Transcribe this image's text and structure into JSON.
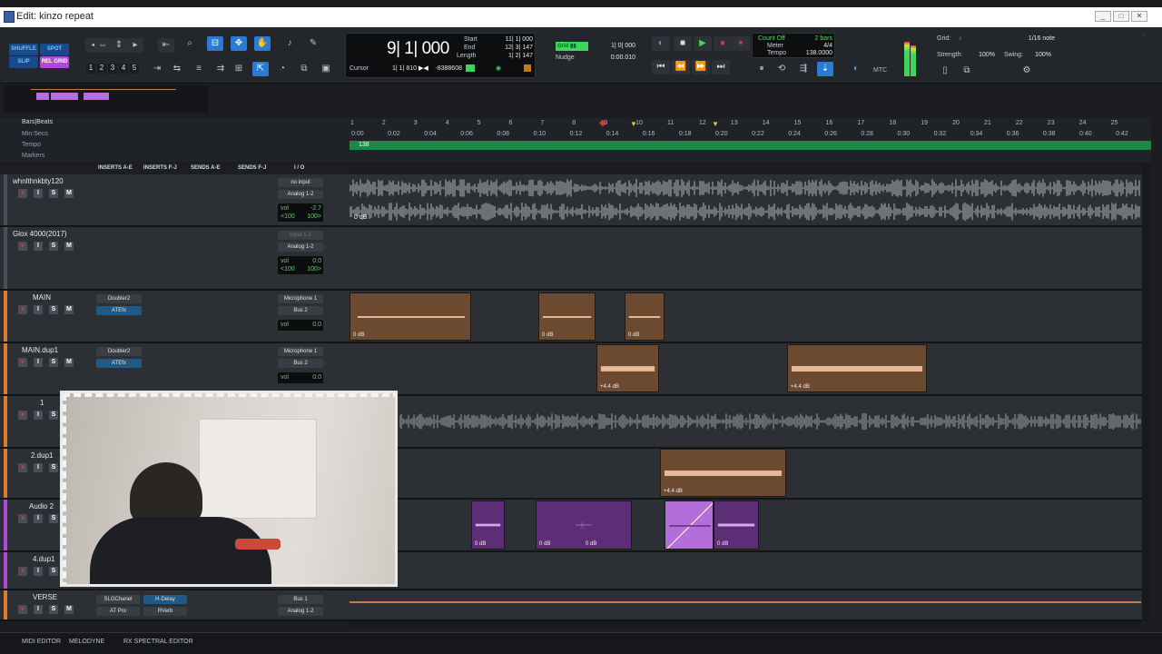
{
  "window": {
    "title": "Edit: kinzo repeat",
    "icon": "pro-tools-icon"
  },
  "modes": {
    "shuffle": "SHUFFLE",
    "spot": "SPOT",
    "slip": "SLIP",
    "grid": "REL GRID"
  },
  "zoom_presets": [
    "1",
    "2",
    "3",
    "4",
    "5"
  ],
  "counter": {
    "main": "9| 1| 000",
    "cursor_label": "Cursor",
    "cursor_value": "1| 1| 810",
    "cursor_extra": "-8388608",
    "start_label": "Start",
    "start_value": "11| 1| 000",
    "end_label": "End",
    "end_value": "12| 3| 147",
    "length_label": "Length",
    "length_value": "1| 2| 147"
  },
  "grid": {
    "grid_label": "Grid",
    "grid_value": "1| 0| 000",
    "nudge_label": "Nudge",
    "nudge_value": "0:00.010"
  },
  "tempo": {
    "count_off_label": "Count Off",
    "count_off_value": "2 bars",
    "meter_label": "Meter",
    "meter_value": "4/4",
    "tempo_label": "Tempo",
    "tempo_value": "138.0000"
  },
  "mtc_label": "MTC",
  "grid_panel": {
    "grid_label": "Grid:",
    "grid_value": "1/16 note",
    "strength_label": "Strength:",
    "strength_value": "100%",
    "swing_label": "Swing:",
    "swing_value": "100%"
  },
  "rulers": {
    "bars_beats": "Bars|Beats",
    "min_secs": "Min:Secs",
    "tempo": "Tempo",
    "markers": "Markers",
    "tempo_marker": "138"
  },
  "bar_ticks": [
    "1",
    "2",
    "3",
    "4",
    "5",
    "6",
    "7",
    "8",
    "9",
    "10",
    "11",
    "12",
    "13",
    "14",
    "15",
    "16",
    "17",
    "18",
    "19",
    "20",
    "21",
    "22",
    "23",
    "24",
    "25"
  ],
  "time_ticks": [
    "0:00",
    "0:02",
    "0:04",
    "0:06",
    "0:08",
    "0:10",
    "0:12",
    "0:14",
    "0:16",
    "0:18",
    "0:20",
    "0:22",
    "0:24",
    "0:26",
    "0:28",
    "0:30",
    "0:32",
    "0:34",
    "0:36",
    "0:38",
    "0:40",
    "0:42"
  ],
  "column_headers": {
    "inserts_ae": "INSERTS A-E",
    "inserts_fj": "INSERTS F-J",
    "sends_ae": "SENDS A-E",
    "sends_fj": "SENDS F-J",
    "io": "I / O"
  },
  "tracks": [
    {
      "name": "whnlthnkbty120",
      "io_in": "no input",
      "io_out": "Analog 1-2",
      "vol": "-2.7",
      "pan_l": "<100",
      "pan_r": "100>",
      "view": "wave",
      "mode": "read",
      "db_label": "0 dB"
    },
    {
      "name": "Glox 4000(2017)",
      "io_in": "Input 1-2",
      "io_out": "Analog 1-2",
      "vol": "0.0",
      "pan_l": "<100",
      "pan_r": "100>",
      "view": "waveform",
      "dyn": "dyn",
      "mode": "read"
    },
    {
      "name": "MAIN",
      "insert1": "Doubler2",
      "insert2": "ATEfx",
      "io_in": "Microphone 1",
      "io_out": "Bus 2",
      "vol": "0.0",
      "view": "wave",
      "mode": "read"
    },
    {
      "name": "MAIN.dup1",
      "insert1": "Doubler2",
      "insert2": "ATEfx",
      "io_in": "Microphone 1",
      "io_out": "Bus 2",
      "vol": "0.0",
      "view": "wave",
      "mode": "read"
    },
    {
      "name": "1",
      "view": "wave"
    },
    {
      "name": "2.dup1",
      "view": "wave"
    },
    {
      "name": "Audio 2",
      "view": "play"
    },
    {
      "name": "4.dup1"
    },
    {
      "name": "VERSE",
      "insert1": "SLGChanel",
      "insert2": "AT Pro",
      "insert3": "H-Delay",
      "insert4": "RVerb",
      "io_in": "Bus 1",
      "io_out": "Analog 1-2"
    }
  ],
  "clips": {
    "main": [
      "0 dB",
      "0 dB",
      "0 dB"
    ],
    "main_dup": [
      "+4.4 dB",
      "+4.4 dB"
    ],
    "dup2": [
      "+4.4 dB"
    ],
    "audio2": [
      "0 dB",
      "0 dB",
      "0 dB",
      "0 dB"
    ]
  },
  "footer": {
    "tabs": [
      "MIDI EDITOR",
      "MELODYNE",
      "RX SPECTRAL EDITOR"
    ]
  },
  "colors": {
    "accent": "#2a7bd1",
    "clip_brown": "#6b4a30",
    "clip_purple": "#5e2d78",
    "tempo_green": "#1a8a46",
    "record_red": "#d43c3c"
  }
}
